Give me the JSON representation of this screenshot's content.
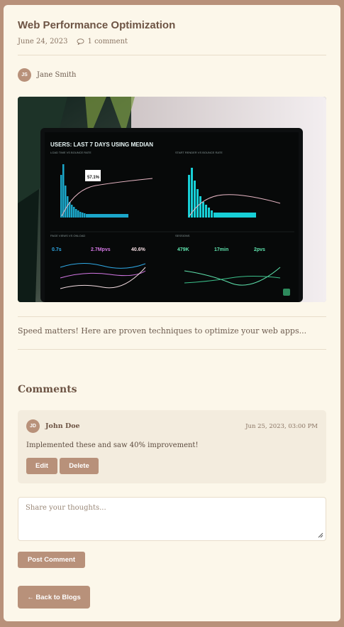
{
  "post": {
    "title": "Web Performance Optimization",
    "date": "June 24, 2023",
    "comment_count": "1 comment",
    "author_initials": "JS",
    "author_name": "Jane Smith",
    "excerpt": "Speed matters! Here are proven techniques to optimize your web apps...",
    "hero_image": {
      "header": "USERS: LAST 7 DAYS USING MEDIAN",
      "panels": [
        {
          "title": "LOAD TIME VS BOUNCE RATE",
          "callout": "57.1%"
        },
        {
          "title": "START RENDER VS BOUNCE RATE"
        },
        {
          "title": "PAGE VIEWS VS ONLOAD",
          "metrics": [
            "0.7s",
            "2.7Mpvs",
            "40.6%"
          ]
        },
        {
          "title": "SESSIONS",
          "metrics": [
            "479K",
            "17min",
            "2pvs"
          ]
        }
      ]
    }
  },
  "comments_section": {
    "heading": "Comments",
    "items": [
      {
        "initials": "JD",
        "name": "John Doe",
        "date": "Jun 25, 2023, 03:00 PM",
        "text": "Implemented these and saw 40% improvement!",
        "edit_label": "Edit",
        "delete_label": "Delete"
      }
    ],
    "input_placeholder": "Share your thoughts...",
    "post_label": "Post Comment"
  },
  "nav": {
    "back_label": "← Back to Blogs"
  },
  "colors": {
    "accent": "#b8917a",
    "card_bg": "#fcf7ea",
    "comment_bg": "#f3ecde"
  }
}
